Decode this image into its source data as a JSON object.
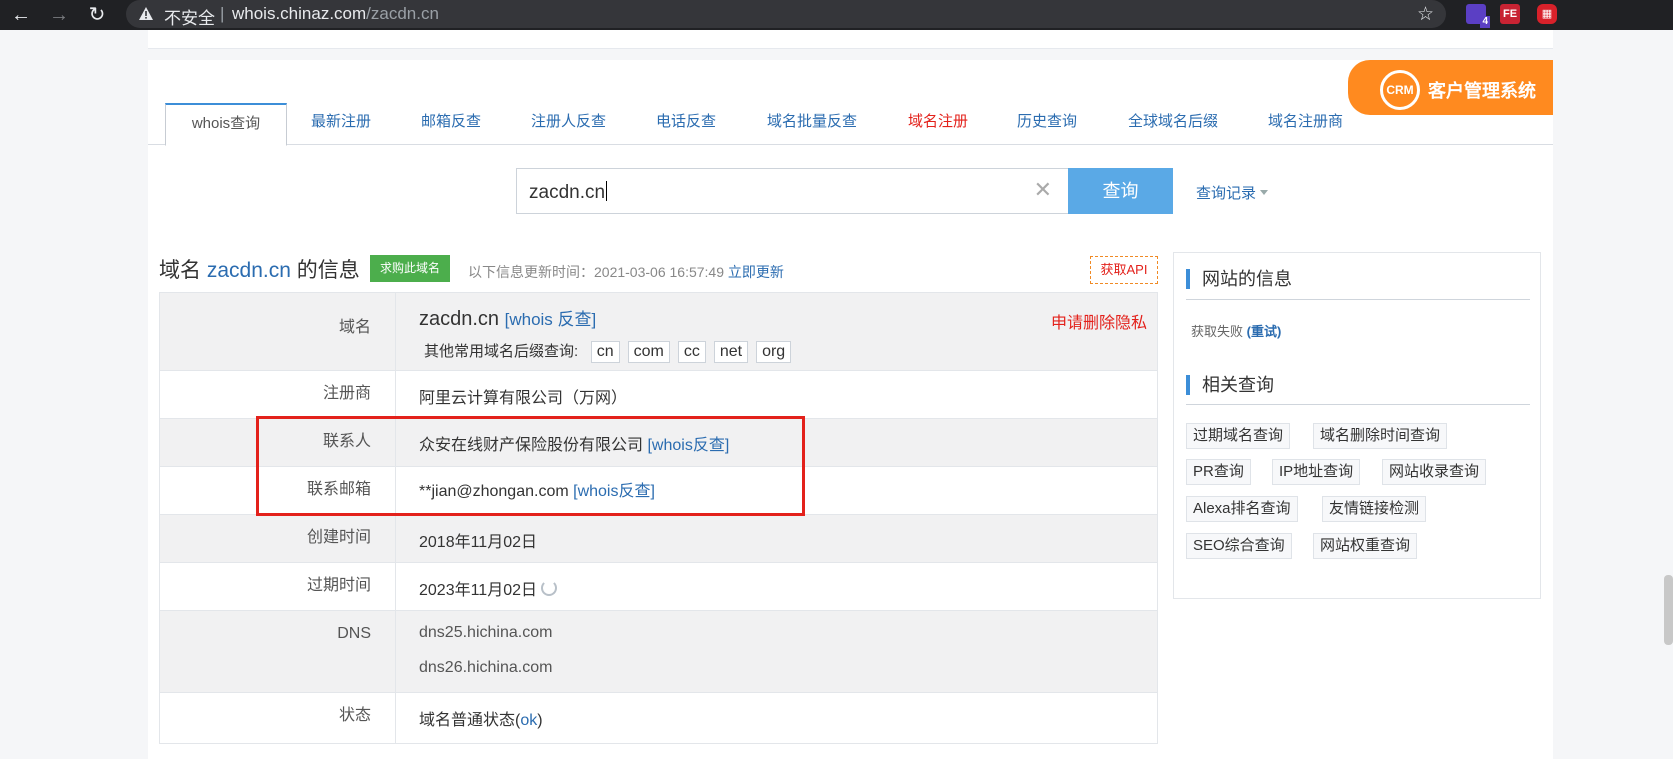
{
  "browser": {
    "insecure_label": "不安全",
    "separator": "|",
    "url_host": "whois.chinaz.com",
    "url_path": "/zacdn.cn",
    "ext_badge_count": "4",
    "ext_fe_label": "FE"
  },
  "tabs": [
    {
      "label": "whois查询",
      "active": true
    },
    {
      "label": "最新注册"
    },
    {
      "label": "邮箱反查"
    },
    {
      "label": "注册人反查"
    },
    {
      "label": "电话反查"
    },
    {
      "label": "域名批量反查"
    },
    {
      "label": "域名注册",
      "color": "#e3211b"
    },
    {
      "label": "历史查询"
    },
    {
      "label": "全球域名后缀"
    },
    {
      "label": "域名注册商"
    }
  ],
  "crm": {
    "badge": "CRM",
    "label": "客户管理系统"
  },
  "search": {
    "value": "zacdn.cn",
    "clear_glyph": "✕",
    "button_label": "查询",
    "history_label": "查询记录"
  },
  "info": {
    "prefix": "域名 ",
    "domain": "zacdn.cn",
    "suffix": " 的信息",
    "buy_badge": "求购此域名",
    "updated_label": "以下信息更新时间：",
    "updated_time": "2021-03-06 16:57:49",
    "update_now": "立即更新",
    "api_label": "获取API"
  },
  "table": {
    "domain": {
      "label": "域名",
      "value": "zacdn.cn",
      "link": "[whois 反查]",
      "privacy": "申请删除隐私",
      "tld_label": "其他常用域名后缀查询:",
      "tlds": [
        "cn",
        "com",
        "cc",
        "net",
        "org"
      ]
    },
    "registrar": {
      "label": "注册商",
      "value": "阿里云计算有限公司（万网）"
    },
    "contact": {
      "label": "联系人",
      "value": "众安在线财产保险股份有限公司",
      "link": "[whois反查]"
    },
    "email": {
      "label": "联系邮箱",
      "value": "**jian@zhongan.com",
      "link": "[whois反查]"
    },
    "created": {
      "label": "创建时间",
      "value": "2018年11月02日"
    },
    "expires": {
      "label": "过期时间",
      "value": "2023年11月02日"
    },
    "dns": {
      "label": "DNS",
      "values": [
        "dns25.hichina.com",
        "dns26.hichina.com"
      ]
    },
    "status": {
      "label": "状态",
      "value_prefix": "域名普通状态(",
      "value_link": "ok",
      "value_suffix": ")"
    }
  },
  "sidebar": {
    "site_info_title": "网站的信息",
    "fail_text": "获取失败",
    "retry_label": "(重试)",
    "related_title": "相关查询",
    "related": [
      "过期域名查询",
      "域名删除时间查询",
      "PR查询",
      "IP地址查询",
      "网站收录查询",
      "Alexa排名查询",
      "友情链接检测",
      "SEO综合查询",
      "网站权重查询"
    ]
  },
  "colors": {
    "accent": "#2b6cb0",
    "danger": "#e3211b",
    "button": "#5aa9e6",
    "crm": "#ff8a1f",
    "badge_green": "#4cae4c"
  }
}
